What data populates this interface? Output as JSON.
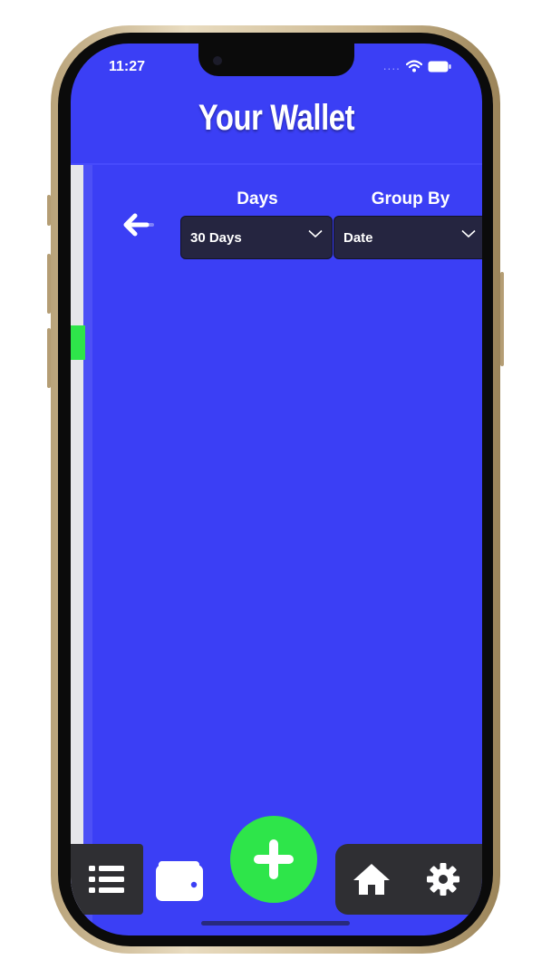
{
  "status_bar": {
    "time": "11:27",
    "signal_dots": "....",
    "icons": [
      "wifi-icon",
      "battery-icon"
    ]
  },
  "header": {
    "title": "Your Wallet"
  },
  "filters": {
    "days": {
      "label": "Days",
      "selected": "30 Days"
    },
    "group_by": {
      "label": "Group By",
      "selected": "Date"
    }
  },
  "nav": {
    "left": [
      "list-icon",
      "wallet-icon"
    ],
    "center": "plus-icon",
    "right": [
      "home-icon",
      "settings-gear-icon"
    ]
  },
  "colors": {
    "background": "#3b3ff5",
    "select_bg": "#252540",
    "accent_green": "#2ee54a",
    "nav_pill": "#2f2f33",
    "text": "#ffffff"
  }
}
